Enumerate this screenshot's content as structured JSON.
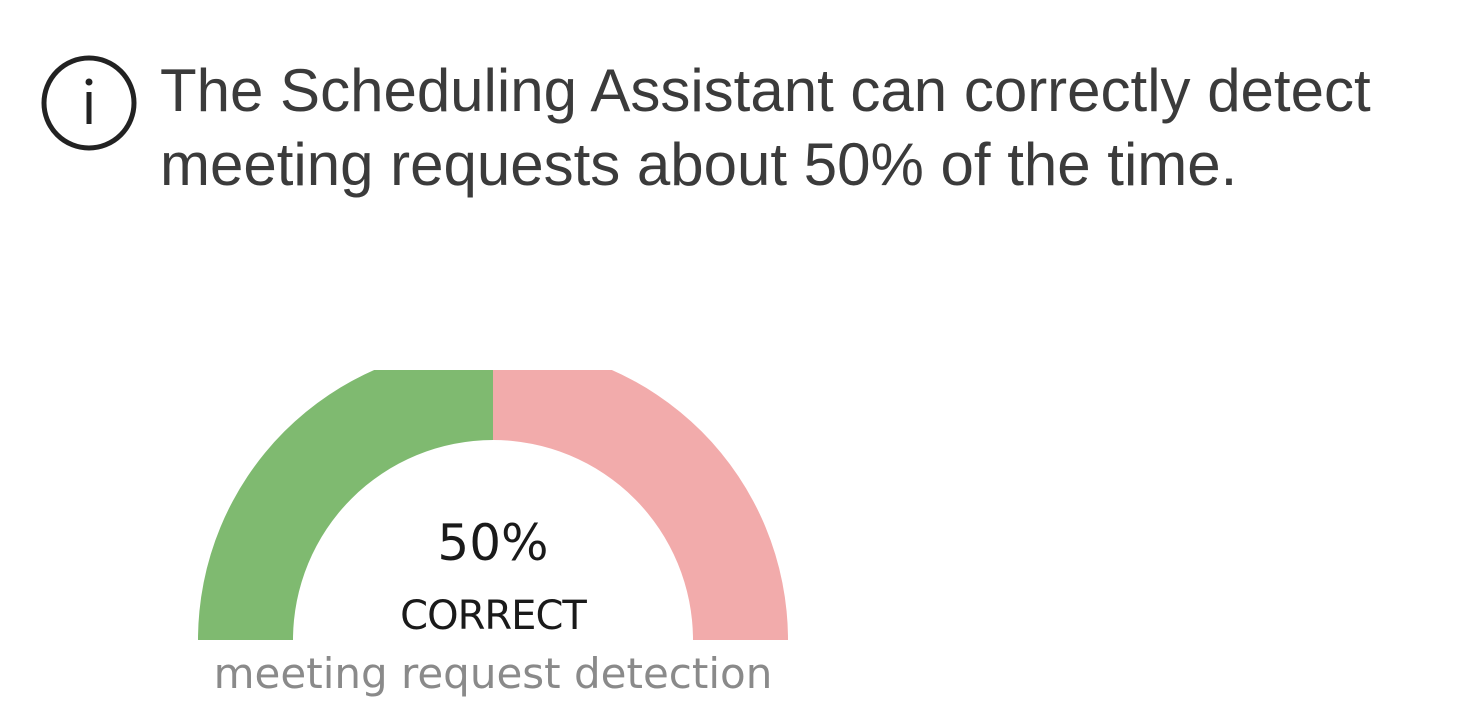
{
  "message": {
    "icon": "info-icon",
    "line1": "The Scheduling Assistant can correctly detect",
    "line2": "meeting requests about 50% of the time."
  },
  "gauge": {
    "percent_correct": 50,
    "value_label": "50%",
    "status_label": "CORRECT",
    "caption": "meeting request detection",
    "colors": {
      "correct": "#7fba70",
      "incorrect": "#f2abab"
    }
  }
}
